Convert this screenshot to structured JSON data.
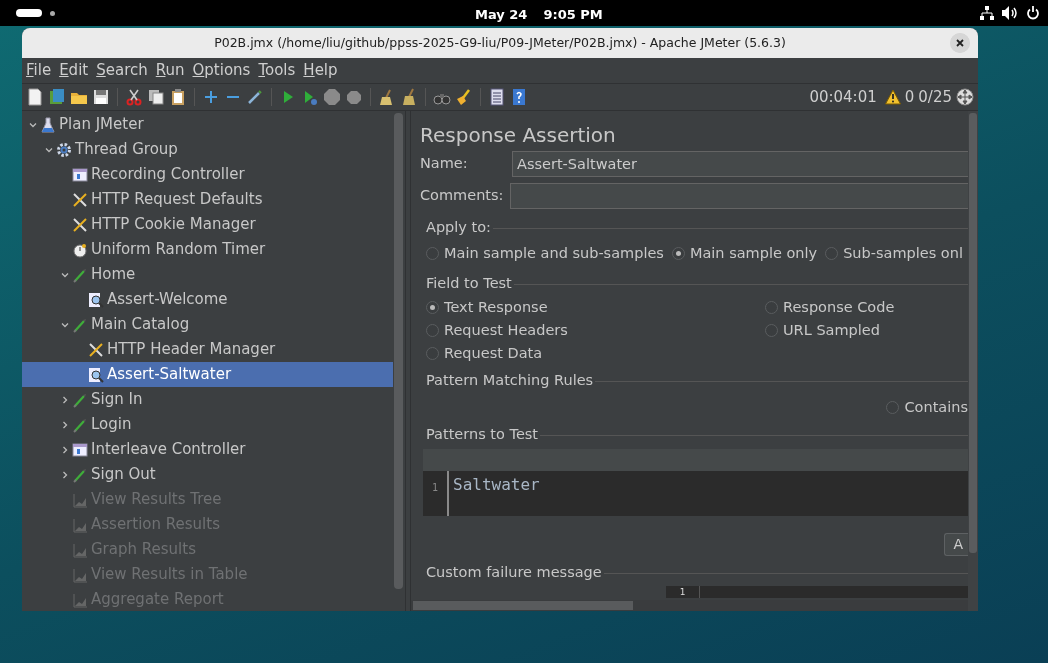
{
  "top_bar": {
    "date": "May 24",
    "time": "9:05 PM"
  },
  "window": {
    "title": "P02B.jmx (/home/liu/github/ppss-2025-G9-liu/P09-JMeter/P02B.jmx) - Apache JMeter (5.6.3)"
  },
  "menu": [
    "File",
    "Edit",
    "Search",
    "Run",
    "Options",
    "Tools",
    "Help"
  ],
  "status": {
    "elapsed": "00:04:01",
    "warnings": "0",
    "threads": "0/25"
  },
  "tree": [
    {
      "label": "Plan JMeter",
      "kind": "plan",
      "expanded": true,
      "selected": false,
      "disabled": false,
      "children": [
        {
          "label": "Thread Group",
          "kind": "thread-group",
          "expanded": true,
          "selected": false,
          "disabled": false,
          "children": [
            {
              "label": "Recording Controller",
              "kind": "controller",
              "selected": false,
              "disabled": false
            },
            {
              "label": "HTTP Request Defaults",
              "kind": "config",
              "selected": false,
              "disabled": false
            },
            {
              "label": "HTTP Cookie Manager",
              "kind": "config",
              "selected": false,
              "disabled": false
            },
            {
              "label": "Uniform Random Timer",
              "kind": "timer",
              "selected": false,
              "disabled": false
            },
            {
              "label": "Home",
              "kind": "sampler",
              "expanded": true,
              "selected": false,
              "disabled": false,
              "children": [
                {
                  "label": "Assert-Welcome",
                  "kind": "assertion",
                  "selected": false,
                  "disabled": false
                }
              ]
            },
            {
              "label": "Main Catalog",
              "kind": "sampler",
              "expanded": true,
              "selected": false,
              "disabled": false,
              "children": [
                {
                  "label": "HTTP Header Manager",
                  "kind": "config",
                  "selected": false,
                  "disabled": false
                },
                {
                  "label": "Assert-Saltwater",
                  "kind": "assertion",
                  "selected": true,
                  "disabled": false
                }
              ]
            },
            {
              "label": "Sign In",
              "kind": "sampler",
              "expanded": false,
              "selected": false,
              "disabled": false
            },
            {
              "label": "Login",
              "kind": "sampler",
              "expanded": false,
              "selected": false,
              "disabled": false
            },
            {
              "label": "Interleave Controller",
              "kind": "controller",
              "expanded": false,
              "selected": false,
              "disabled": false
            },
            {
              "label": "Sign Out",
              "kind": "sampler",
              "expanded": false,
              "selected": false,
              "disabled": false
            },
            {
              "label": "View Results Tree",
              "kind": "listener",
              "selected": false,
              "disabled": true
            },
            {
              "label": "Assertion Results",
              "kind": "listener",
              "selected": false,
              "disabled": true
            },
            {
              "label": "Graph Results",
              "kind": "listener",
              "selected": false,
              "disabled": true
            },
            {
              "label": "View Results in Table",
              "kind": "listener",
              "selected": false,
              "disabled": true
            },
            {
              "label": "Aggregate Report",
              "kind": "listener",
              "selected": false,
              "disabled": true
            }
          ]
        }
      ]
    }
  ],
  "editor": {
    "title": "Response Assertion",
    "name_label": "Name:",
    "name_value": "Assert-Saltwater",
    "comments_label": "Comments:",
    "apply_to": {
      "legend": "Apply to:",
      "options": [
        {
          "label": "Main sample and sub-samples",
          "selected": false
        },
        {
          "label": "Main sample only",
          "selected": true
        },
        {
          "label": "Sub-samples onl",
          "selected": false
        }
      ]
    },
    "field_to_test": {
      "legend": "Field to Test",
      "options": [
        {
          "label": "Text Response",
          "selected": true
        },
        {
          "label": "Response Code",
          "selected": false
        },
        {
          "label": "Request Headers",
          "selected": false
        },
        {
          "label": "URL Sampled",
          "selected": false
        },
        {
          "label": "Request Data",
          "selected": false
        }
      ]
    },
    "pattern_rules": {
      "legend": "Pattern Matching Rules",
      "options": [
        {
          "label": "Contains",
          "selected": false
        }
      ]
    },
    "patterns": {
      "legend": "Patterns to Test",
      "lines": [
        {
          "number": "1",
          "text": "Saltwater"
        }
      ]
    },
    "add_button": "A",
    "failure": {
      "legend": "Custom failure message",
      "line_number": "1"
    }
  }
}
